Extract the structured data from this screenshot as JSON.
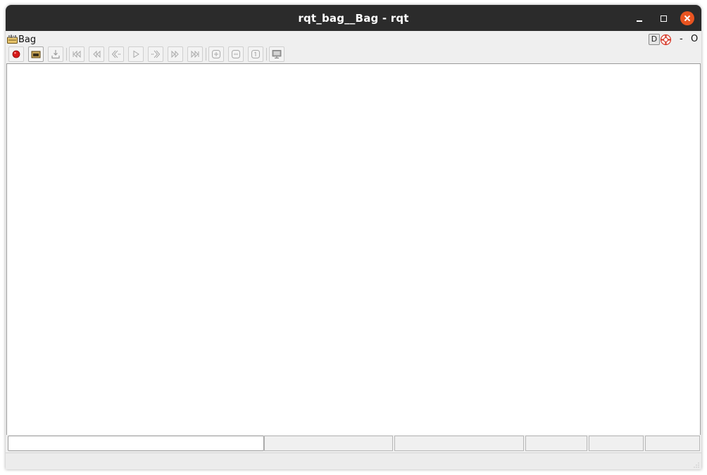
{
  "window": {
    "title": "rqt_bag__Bag - rqt"
  },
  "plugin": {
    "title": "Bag",
    "icon": "bag-plugin-icon",
    "header_buttons": {
      "d_label": "D",
      "help_icon": "help-lifebuoy-icon",
      "minimize_label": "-",
      "close_label": "O"
    }
  },
  "toolbar": {
    "buttons": [
      {
        "name": "record",
        "icon": "record-icon",
        "enabled": true
      },
      {
        "name": "open",
        "icon": "folder-open-icon",
        "enabled": true
      },
      {
        "name": "save",
        "icon": "save-icon",
        "enabled": false
      },
      {
        "name": "begin",
        "icon": "skip-to-begin-icon",
        "enabled": false
      },
      {
        "name": "rewind",
        "icon": "rewind-icon",
        "enabled": false
      },
      {
        "name": "step-back",
        "icon": "step-back-icon",
        "enabled": false
      },
      {
        "name": "play",
        "icon": "play-icon",
        "enabled": false
      },
      {
        "name": "step-forward",
        "icon": "step-forward-icon",
        "enabled": false
      },
      {
        "name": "fast-forward",
        "icon": "fast-forward-icon",
        "enabled": false
      },
      {
        "name": "end",
        "icon": "skip-to-end-icon",
        "enabled": false
      },
      {
        "name": "zoom-in",
        "icon": "zoom-in-icon",
        "enabled": false
      },
      {
        "name": "zoom-out",
        "icon": "zoom-out-icon",
        "enabled": false
      },
      {
        "name": "zoom-reset",
        "icon": "zoom-reset-icon",
        "enabled": false
      },
      {
        "name": "thumbnails",
        "icon": "thumbnails-icon",
        "enabled": false
      }
    ]
  },
  "status": {
    "filter_value": "",
    "fields": [
      "",
      "",
      "",
      "",
      ""
    ]
  },
  "colors": {
    "titlebar": "#2b2b2b",
    "close_button": "#e95420",
    "record_red": "#d61a1a"
  }
}
